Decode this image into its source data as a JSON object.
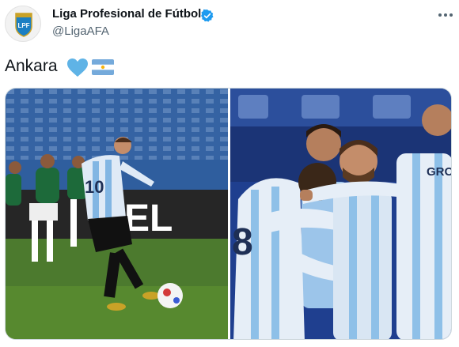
{
  "account": {
    "name": "Liga Profesional de Fútbol",
    "handle": "@LigaAFA",
    "avatar_text": "LPF",
    "verified_icon": "verified-badge-icon",
    "brand_color": "#1d9bf0"
  },
  "tweet": {
    "text": "Ankara",
    "emoji": [
      "light-blue-heart-icon",
      "argentina-flag-icon"
    ]
  },
  "media": {
    "left_ad_text": "EL",
    "right_shirt_text": "GRO",
    "player_number_left": "10",
    "player_number_right": "8"
  }
}
